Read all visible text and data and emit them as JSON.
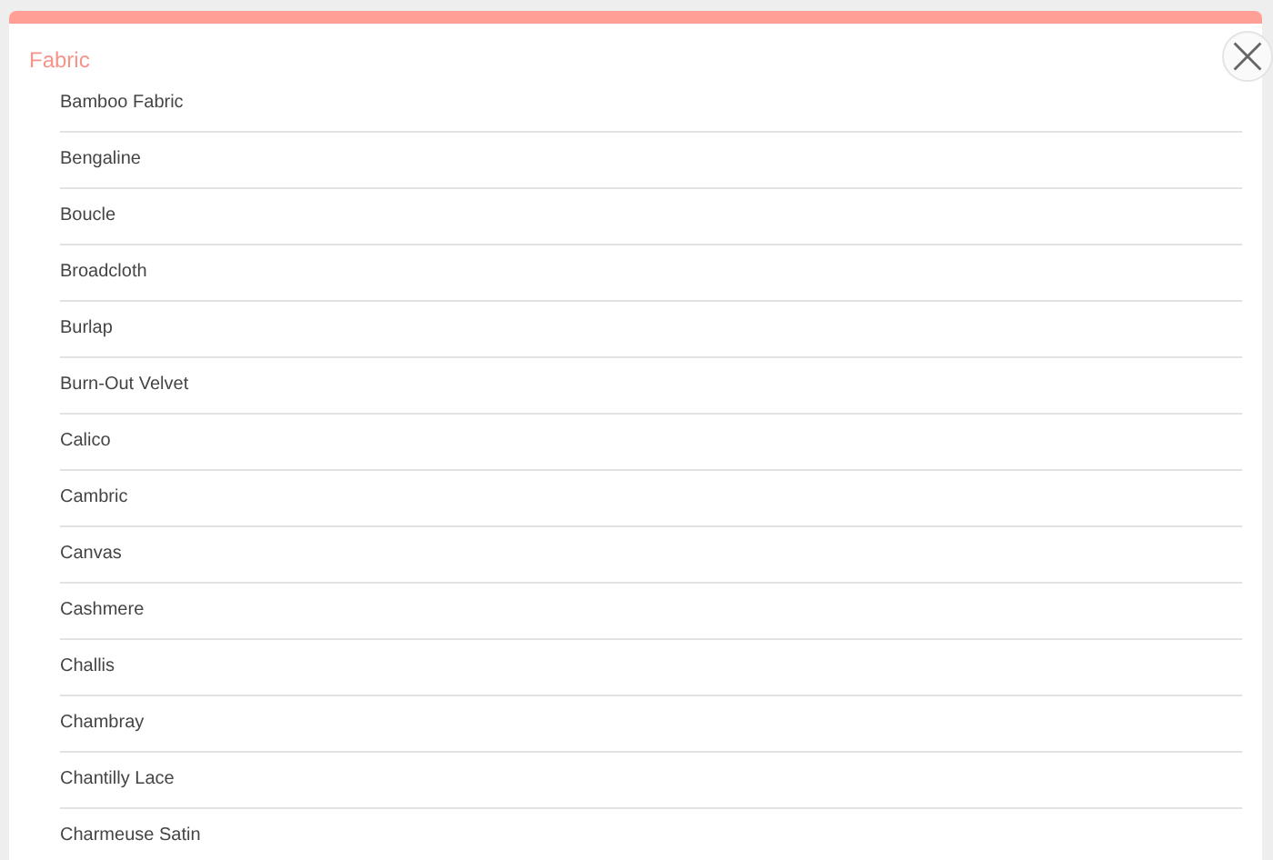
{
  "panel": {
    "title": "Fabric"
  },
  "items": [
    "Bamboo Fabric",
    "Bengaline",
    "Boucle",
    "Broadcloth",
    "Burlap",
    "Burn-Out Velvet",
    "Calico",
    "Cambric",
    "Canvas",
    "Cashmere",
    "Challis",
    "Chambray",
    "Chantilly Lace",
    "Charmeuse Satin"
  ]
}
